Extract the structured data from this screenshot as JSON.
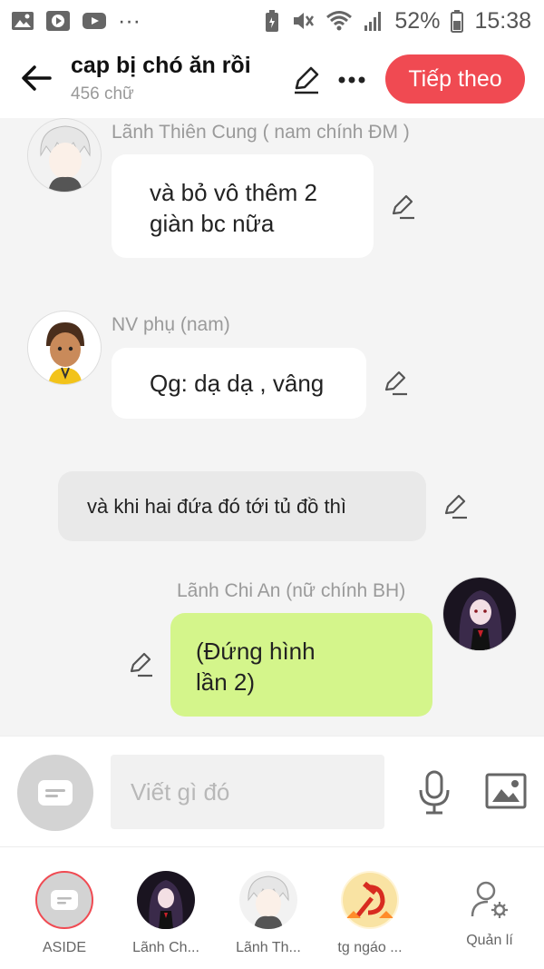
{
  "status_bar": {
    "battery": "52%",
    "time": "15:38",
    "more": "···"
  },
  "header": {
    "title": "cap bị chó ăn rồi",
    "word_count": "456 chữ",
    "next_label": "Tiếp theo"
  },
  "messages": [
    {
      "speaker": "Lãnh Thiên Cung ( nam chính ĐM )",
      "lines": [
        "và bỏ vô thêm 2",
        "giàn bc nữa"
      ],
      "avatar": "white-hair-boy-avatar"
    },
    {
      "speaker": "NV phụ (nam)",
      "lines": [
        "Qg: dạ dạ , vâng"
      ],
      "avatar": "brown-hair-boy-avatar"
    },
    {
      "narration": "và khi hai đứa đó tới tủ đồ thì"
    },
    {
      "speaker": "Lãnh Chi An (nữ chính BH)",
      "lines": [
        "(Đứng hình",
        "lần 2)"
      ],
      "avatar": "dark-hair-girl-avatar"
    }
  ],
  "input": {
    "placeholder": "Viết gì đó"
  },
  "tabs": [
    {
      "label": "ASIDE"
    },
    {
      "label": "Lãnh Ch..."
    },
    {
      "label": "Lãnh Th..."
    },
    {
      "label": "tg ngáo ..."
    },
    {
      "label": "Quản lí"
    }
  ],
  "colors": {
    "accent": "#f04a52",
    "bubble_green": "#d4f58b",
    "bubble_white": "#ffffff",
    "narration_gray": "#e9e9e9"
  }
}
